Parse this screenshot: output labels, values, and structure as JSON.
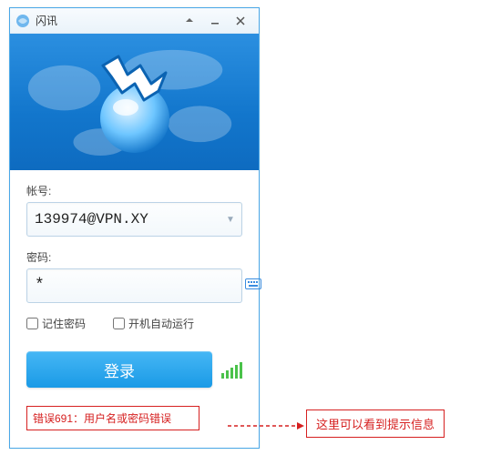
{
  "window": {
    "title": "闪讯"
  },
  "form": {
    "account_label": "帐号:",
    "account_value": "139974@VPN.XY",
    "password_label": "密码:",
    "password_value": "*",
    "remember_label": "记住密码",
    "autostart_label": "开机自动运行",
    "login_label": "登录"
  },
  "error": {
    "text": "错误691：用户名或密码错误"
  },
  "annotation": {
    "text": "这里可以看到提示信息"
  }
}
